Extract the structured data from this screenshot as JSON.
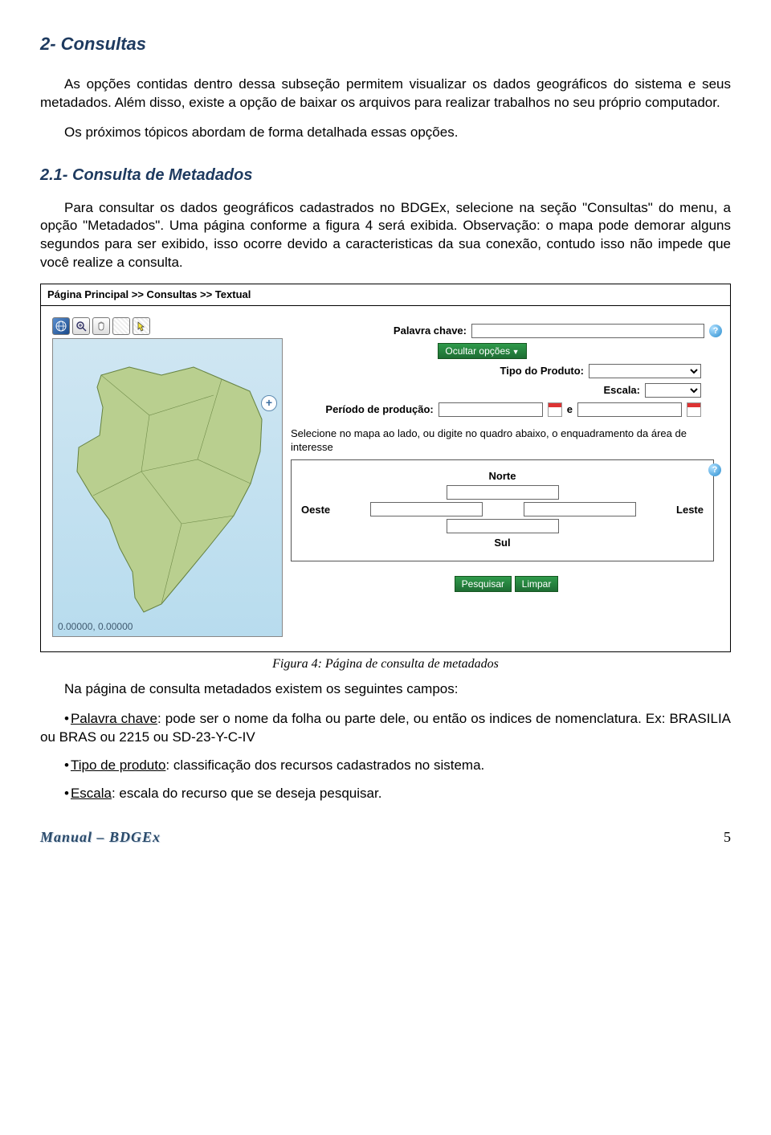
{
  "h1": "2- Consultas",
  "p1": "As opções contidas dentro dessa subseção permitem visualizar os dados geográficos do sistema e seus metadados. Além disso, existe a opção de baixar os arquivos para realizar trabalhos no seu próprio computador.",
  "p2": "Os próximos tópicos abordam de forma detalhada essas opções.",
  "h2": "2.1- Consulta de Metadados",
  "p3": "Para consultar os dados geográficos cadastrados no BDGEx, selecione na seção \"Consultas\" do menu, a opção \"Metadados\". Uma página conforme a figura 4 será exibida. Observação: o mapa pode demorar alguns segundos para ser exibido, isso ocorre devido a caracteristicas da sua conexão, contudo isso não impede que você realize a consulta.",
  "app": {
    "breadcrumb": "Página Principal >> Consultas >> Textual",
    "coords": "0.00000, 0.00000",
    "labels": {
      "keyword": "Palavra chave:",
      "hide": "Ocultar opções",
      "tipo": "Tipo do Produto:",
      "escala": "Escala:",
      "periodo": "Período de produção:",
      "e": "e",
      "note": "Selecione no mapa ao lado, ou digite no quadro abaixo, o enquadramento da área de interesse",
      "norte": "Norte",
      "sul": "Sul",
      "oeste": "Oeste",
      "leste": "Leste",
      "pesquisar": "Pesquisar",
      "limpar": "Limpar"
    }
  },
  "caption": "Figura 4: Página de consulta de metadados",
  "p4": "Na página de consulta metadados existem os seguintes campos:",
  "fields": [
    {
      "label": "Palavra chave",
      "text": ": pode ser o nome da folha ou parte dele, ou então os indices de nomenclatura. Ex: BRASILIA ou BRAS ou 2215 ou SD-23-Y-C-IV"
    },
    {
      "label": "Tipo de produto",
      "text": ": classificação dos recursos cadastrados no sistema."
    },
    {
      "label": "Escala",
      "text": ": escala do recurso que se deseja pesquisar."
    }
  ],
  "footer": {
    "left": "Manual – BDGEx",
    "page": "5"
  }
}
